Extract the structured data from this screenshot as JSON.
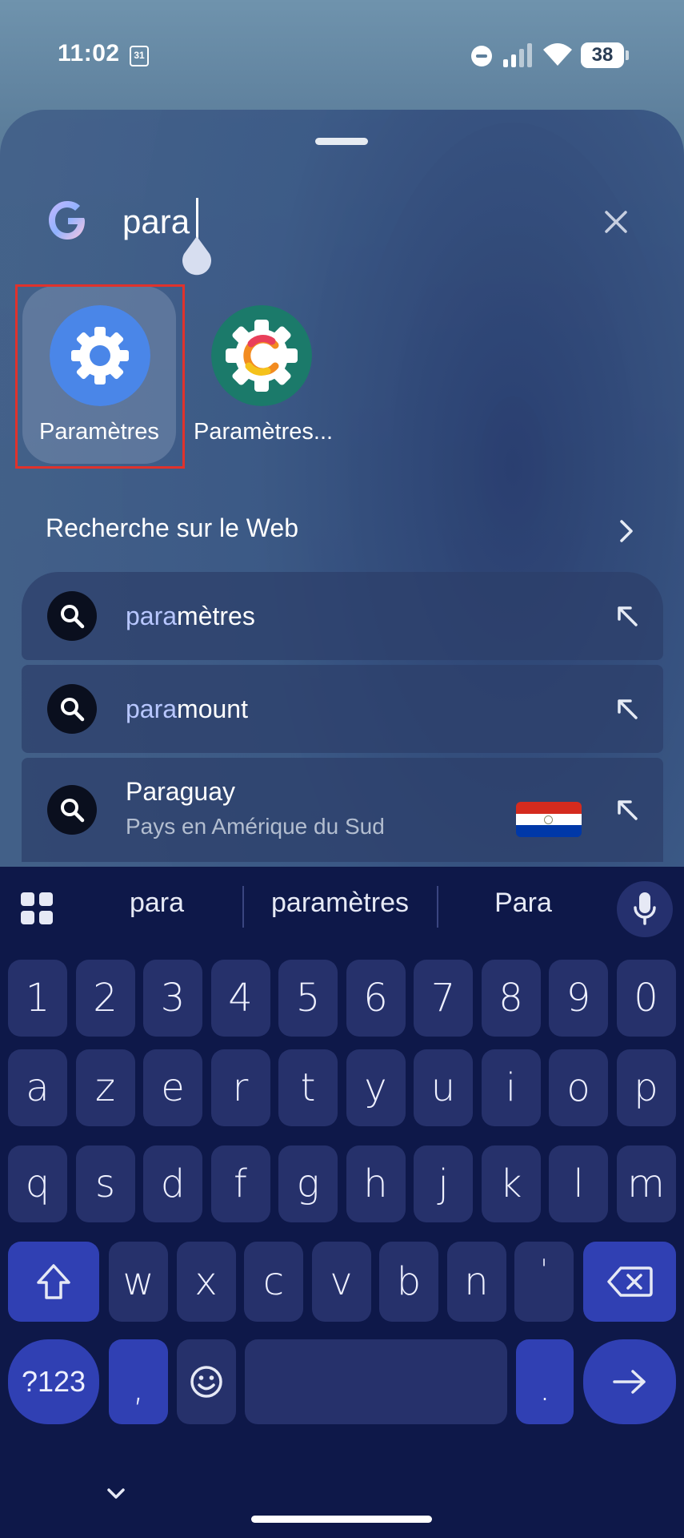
{
  "status_bar": {
    "time": "11:02",
    "calendar_day": "31",
    "battery": "38"
  },
  "search": {
    "query": "para"
  },
  "apps": [
    {
      "label": "Paramètres",
      "icon": "settings-gear-icon",
      "color": "#4a86e8",
      "selected": true
    },
    {
      "label": "Paramètres...",
      "icon": "colored-settings-gear-icon",
      "color": "#1b7a6a",
      "selected": false
    }
  ],
  "web_search": {
    "label": "Recherche sur le Web"
  },
  "suggestions": [
    {
      "highlight": "para",
      "rest": "mètres",
      "subtitle": ""
    },
    {
      "highlight": "para",
      "rest": "mount",
      "subtitle": ""
    },
    {
      "highlight": "",
      "rest": "Paraguay",
      "subtitle": "Pays en Amérique du Sud",
      "flag": [
        "#d52b1e",
        "#ffffff",
        "#0038a8"
      ]
    }
  ],
  "keyboard": {
    "suggestions": [
      "para",
      "paramètres",
      "Para"
    ],
    "rows": [
      [
        "1",
        "2",
        "3",
        "4",
        "5",
        "6",
        "7",
        "8",
        "9",
        "0"
      ],
      [
        "a",
        "z",
        "e",
        "r",
        "t",
        "y",
        "u",
        "i",
        "o",
        "p"
      ],
      [
        "q",
        "s",
        "d",
        "f",
        "g",
        "h",
        "j",
        "k",
        "l",
        "m"
      ],
      [
        "w",
        "x",
        "c",
        "v",
        "b",
        "n",
        "'"
      ]
    ],
    "symbols_key": "?123",
    "comma": ",",
    "period": "."
  }
}
